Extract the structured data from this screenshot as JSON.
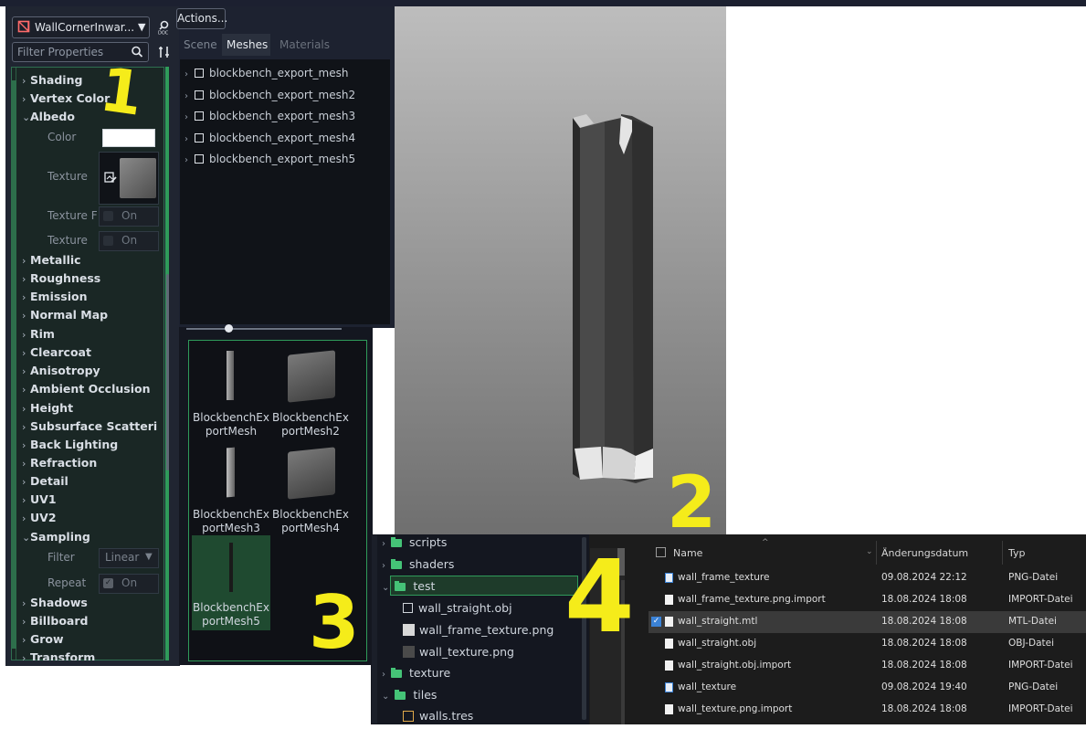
{
  "toolbar": {
    "resource_name": "WallCornerInwar...",
    "filter_placeholder": "Filter Properties",
    "actions_label": "Actions..."
  },
  "inspector": {
    "sections_top": [
      {
        "label": "Shading"
      },
      {
        "label": "Vertex Color"
      },
      {
        "label": "Albedo",
        "expanded": true
      }
    ],
    "albedo": {
      "color_label": "Color",
      "texture_label": "Texture",
      "texture_force_label": "Texture F",
      "texture_force_value": "On",
      "texture_msdf_label": "Texture",
      "texture_msdf_value": "On"
    },
    "sections_mid": [
      {
        "label": "Metallic"
      },
      {
        "label": "Roughness"
      },
      {
        "label": "Emission"
      },
      {
        "label": "Normal Map"
      },
      {
        "label": "Rim"
      },
      {
        "label": "Clearcoat"
      },
      {
        "label": "Anisotropy"
      },
      {
        "label": "Ambient Occlusion"
      },
      {
        "label": "Height"
      },
      {
        "label": "Subsurface Scatteri"
      },
      {
        "label": "Back Lighting"
      },
      {
        "label": "Refraction"
      },
      {
        "label": "Detail"
      },
      {
        "label": "UV1"
      },
      {
        "label": "UV2"
      },
      {
        "label": "Sampling",
        "expanded": true
      }
    ],
    "sampling": {
      "filter_label": "Filter",
      "filter_value": "Linear",
      "repeat_label": "Repeat",
      "repeat_value": "On"
    },
    "sections_bottom": [
      {
        "label": "Shadows"
      },
      {
        "label": "Billboard"
      },
      {
        "label": "Grow"
      },
      {
        "label": "Transform"
      }
    ]
  },
  "tabs": [
    {
      "label": "Scene",
      "active": false
    },
    {
      "label": "Meshes",
      "active": true
    },
    {
      "label": "Materials",
      "active": false
    }
  ],
  "meshes": [
    "blockbench_export_mesh",
    "blockbench_export_mesh2",
    "blockbench_export_mesh3",
    "blockbench_export_mesh4",
    "blockbench_export_mesh5"
  ],
  "thumbnails": [
    {
      "line1": "BlockbenchEx",
      "line2": "portMesh",
      "shape": "thin"
    },
    {
      "line1": "BlockbenchEx",
      "line2": "portMesh2",
      "shape": "box"
    },
    {
      "line1": "BlockbenchEx",
      "line2": "portMesh3",
      "shape": "thin"
    },
    {
      "line1": "BlockbenchEx",
      "line2": "portMesh4",
      "shape": "box"
    },
    {
      "line1": "BlockbenchEx",
      "line2": "portMesh5",
      "shape": "stick",
      "selected": true
    }
  ],
  "filesystem": [
    {
      "label": "scripts",
      "type": "folder",
      "level": 0,
      "expanded": false
    },
    {
      "label": "shaders",
      "type": "folder",
      "level": 0,
      "expanded": false
    },
    {
      "label": "test",
      "type": "folder",
      "level": 0,
      "expanded": true,
      "selected": true
    },
    {
      "label": "wall_straight.obj",
      "type": "mesh",
      "level": 1
    },
    {
      "label": "wall_frame_texture.png",
      "type": "image-light",
      "level": 1
    },
    {
      "label": "wall_texture.png",
      "type": "image-dark",
      "level": 1
    },
    {
      "label": "texture",
      "type": "folder",
      "level": 0,
      "expanded": false
    },
    {
      "label": "tiles",
      "type": "folder",
      "level": 0,
      "expanded": true
    },
    {
      "label": "walls.tres",
      "type": "resource",
      "level": 1
    }
  ],
  "explorer": {
    "headers": {
      "name": "Name",
      "date": "Änderungsdatum",
      "type": "Typ"
    },
    "rows": [
      {
        "name": "wall_frame_texture",
        "date": "09.08.2024 22:12",
        "type": "PNG-Datei",
        "icon": "image"
      },
      {
        "name": "wall_frame_texture.png.import",
        "date": "18.08.2024 18:08",
        "type": "IMPORT-Datei",
        "icon": "file"
      },
      {
        "name": "wall_straight.mtl",
        "date": "18.08.2024 18:08",
        "type": "MTL-Datei",
        "icon": "file",
        "selected": true
      },
      {
        "name": "wall_straight.obj",
        "date": "18.08.2024 18:08",
        "type": "OBJ-Datei",
        "icon": "file"
      },
      {
        "name": "wall_straight.obj.import",
        "date": "18.08.2024 18:08",
        "type": "IMPORT-Datei",
        "icon": "file"
      },
      {
        "name": "wall_texture",
        "date": "09.08.2024 19:40",
        "type": "PNG-Datei",
        "icon": "image"
      },
      {
        "name": "wall_texture.png.import",
        "date": "18.08.2024 18:08",
        "type": "IMPORT-Datei",
        "icon": "file"
      }
    ]
  },
  "annotations": [
    "1",
    "2",
    "3",
    "4"
  ],
  "colors": {
    "accent_green": "#2f9b5a",
    "folder_green": "#45c377",
    "annotation_yellow": "#f5ec1a"
  }
}
